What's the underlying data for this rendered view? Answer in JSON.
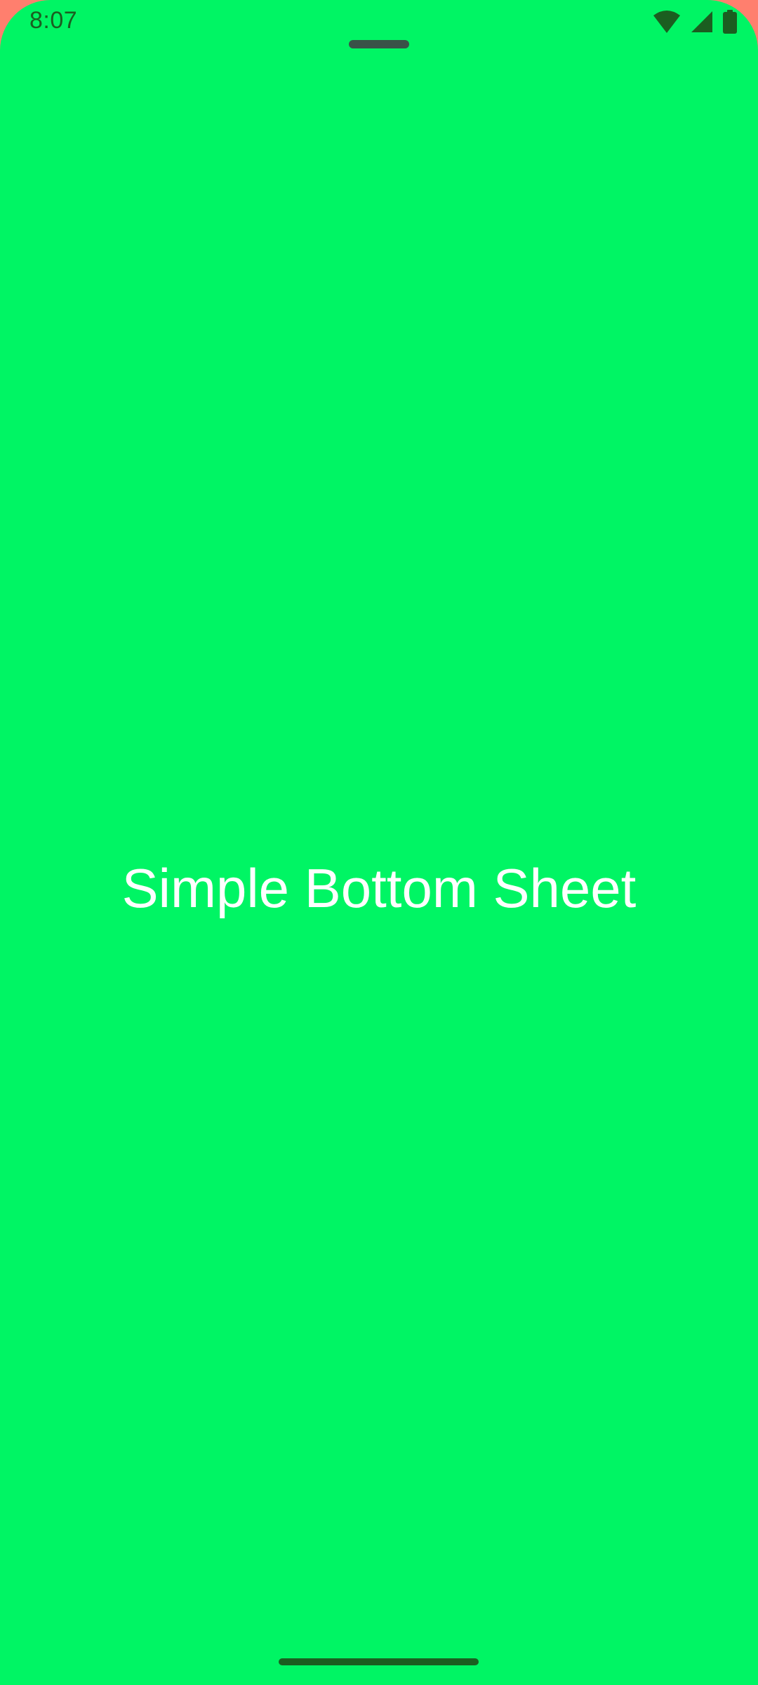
{
  "status_bar": {
    "time": "8:07",
    "icons": [
      "wifi-icon",
      "cellular-signal-icon",
      "battery-icon"
    ]
  },
  "bottom_sheet": {
    "title": "Simple Bottom Sheet",
    "background_color": "#00F564"
  },
  "colors": {
    "scrim": "#FF7F6E",
    "sheet": "#00F564",
    "status_foreground": "#1B5E20",
    "title_text": "#FFFFFF"
  }
}
